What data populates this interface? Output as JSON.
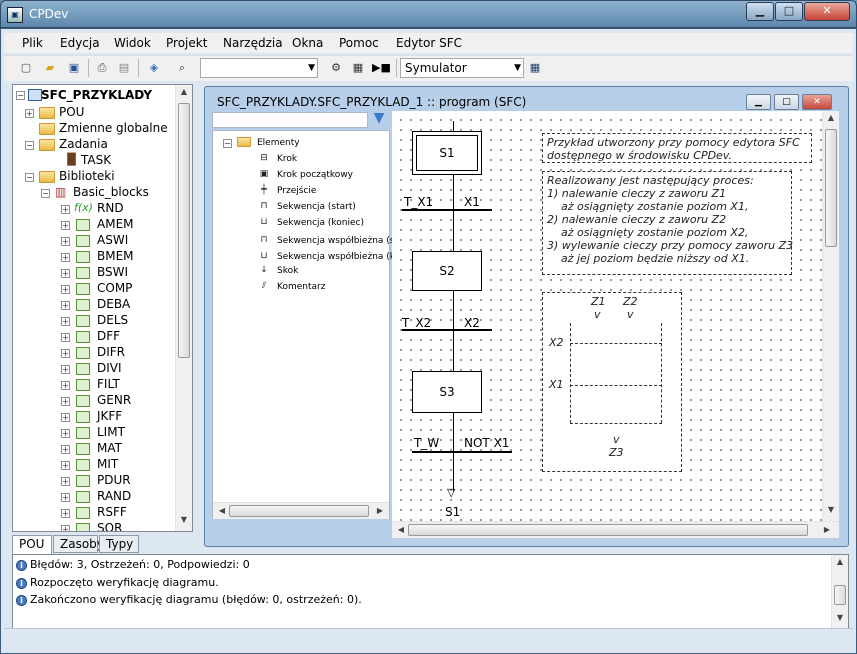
{
  "window": {
    "title": "CPDev",
    "min": "▁",
    "max": "□",
    "close": "✕"
  },
  "menu": [
    "Plik",
    "Edycja",
    "Widok",
    "Projekt",
    "Narzędzia",
    "Okna",
    "Pomoc",
    "Edytor SFC"
  ],
  "toolbar": {
    "simulator_value": "Symulator"
  },
  "tree": {
    "root": "SFC_PRZYKLADY",
    "pou": "POU",
    "globals": "Zmienne globalne",
    "tasks": "Zadania",
    "task": "TASK",
    "libraries": "Biblioteki",
    "basic_blocks": "Basic_blocks",
    "blocks": [
      "RND",
      "AMEM",
      "ASWI",
      "BMEM",
      "BSWI",
      "COMP",
      "DEBA",
      "DELS",
      "DFF",
      "DIFR",
      "DIVI",
      "FILT",
      "GENR",
      "JKFF",
      "LIMT",
      "MAT",
      "MIT",
      "PDUR",
      "RAND",
      "RSFF",
      "SOR"
    ],
    "rnd_icon": "f(x)"
  },
  "bottom_tabs": [
    "POU",
    "Zasoby",
    "Typy"
  ],
  "doc": {
    "title": "SFC_PRZYKLADY.SFC_PRZYKLAD_1 :: program (SFC)",
    "filter_value": ""
  },
  "elements": {
    "root": "Elementy",
    "items": [
      "Krok",
      "Krok początkowy",
      "Przejście",
      "Sekwencja (start)",
      "Sekwencja (koniec)",
      "Sekwencja współbieżna (s",
      "Sekwencja współbieżna (k",
      "Skok",
      "Komentarz"
    ]
  },
  "sfc": {
    "steps": [
      "S1",
      "S2",
      "S3"
    ],
    "transitions": [
      {
        "name": "T_X1",
        "cond": "X1"
      },
      {
        "name": "T_X2",
        "cond": "X2"
      },
      {
        "name": "T_W",
        "cond": "NOT X1"
      }
    ],
    "jump_target": "S1",
    "comment1": "Przykład utworzony przy pomocy edytora SFC\ndostępnego w środowisku CPDev.",
    "comment2": "Realizowany jest następujący proces:\n1) nalewanie cieczy z zaworu Z1\n    aż osiągnięty zostanie poziom X1,\n2) nalewanie cieczy z zaworu Z2\n    aż osiągnięty zostanie poziom X2,\n3) wylewanie cieczy przy pomocy zaworu Z3\n    aż jej poziom będzie niższy od X1.",
    "tank": {
      "z1": "Z1",
      "z2": "Z2",
      "v1": "v",
      "v2": "v",
      "x2": "X2",
      "x1": "X1",
      "v3": "v",
      "z3": "Z3"
    }
  },
  "messages": [
    "Błędów: 3, Ostrzeżeń: 0, Podpowiedzi: 0",
    "Rozpoczęto weryfikację diagramu.",
    "Zakończono weryfikację diagramu (błędów: 0, ostrzeżeń: 0)."
  ]
}
